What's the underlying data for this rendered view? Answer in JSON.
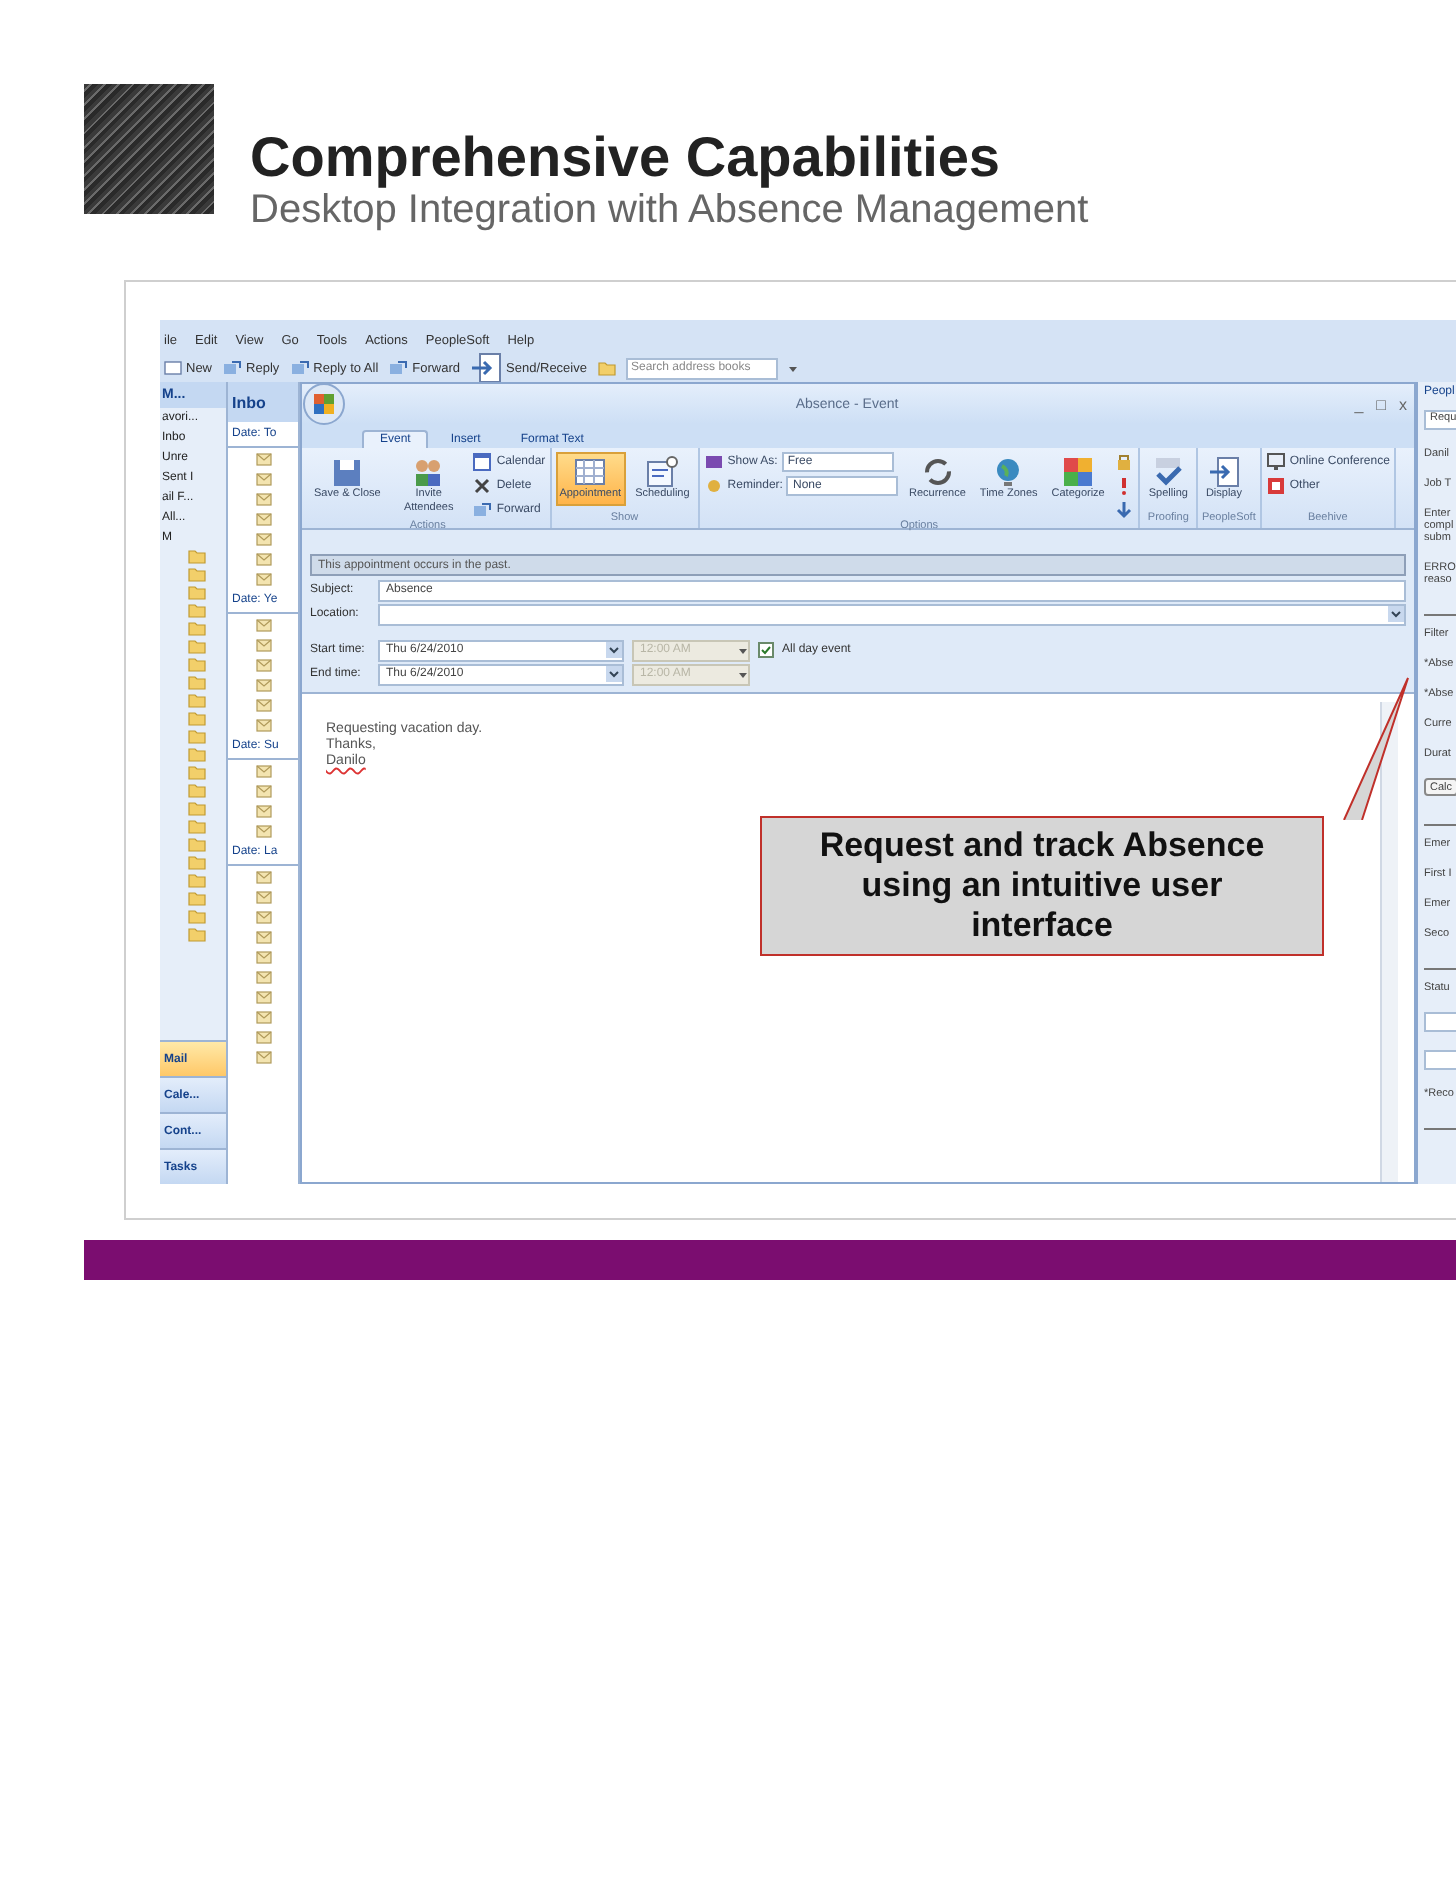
{
  "slide": {
    "title": "Comprehensive Capabilities",
    "subtitle": "Desktop Integration with Absence Management"
  },
  "outlook": {
    "menu": [
      "ile",
      "Edit",
      "View",
      "Go",
      "Tools",
      "Actions",
      "PeopleSoft",
      "Help"
    ],
    "toolbar": {
      "buttons": [
        "New",
        "Reply",
        "Reply to All",
        "Forward",
        "Send/Receive"
      ],
      "search_placeholder": "Search address books"
    },
    "nav_pane": {
      "header": "M...",
      "favorites": "avori...",
      "favorite_folders": [
        "Inbo",
        "Unre",
        "Sent I"
      ],
      "mail_folders": "ail F...",
      "view": "All...",
      "root": "M",
      "buttons": [
        {
          "label": "Mail",
          "selected": true
        },
        {
          "label": "Cale...",
          "selected": false
        },
        {
          "label": "Cont...",
          "selected": false
        },
        {
          "label": "Tasks",
          "selected": false
        }
      ]
    },
    "message_list": {
      "header": "Inbo",
      "groups": [
        "Date: To",
        "Date: Ye",
        "Date: Su",
        "Date: La"
      ]
    },
    "event": {
      "title": "Absence - Event",
      "window_controls": [
        "_",
        "□",
        "x"
      ],
      "tabs": [
        {
          "label": "Event",
          "selected": true
        },
        {
          "label": "Insert",
          "selected": false
        },
        {
          "label": "Format Text",
          "selected": false
        }
      ],
      "ribbon": [
        {
          "label": "Actions",
          "columns": [
            [
              {
                "kind": "large",
                "label": "Save & Close"
              }
            ],
            [
              {
                "kind": "large",
                "label": "Invite Attendees"
              }
            ],
            [
              {
                "kind": "small",
                "label": "Calendar"
              },
              {
                "kind": "small",
                "label": "Delete"
              },
              {
                "kind": "small",
                "label": "Forward"
              }
            ]
          ]
        },
        {
          "label": "Show",
          "columns": [
            [
              {
                "kind": "large",
                "label": "Appointment",
                "selected": true
              }
            ],
            [
              {
                "kind": "large",
                "label": "Scheduling",
                "selected": false
              }
            ]
          ]
        },
        {
          "label": "Options",
          "columns": [
            [
              {
                "kind": "select",
                "label": "Show As:",
                "value": "Free"
              },
              {
                "kind": "select",
                "label": "Reminder:",
                "value": "None"
              }
            ],
            [
              {
                "kind": "large",
                "label": "Recurrence"
              }
            ],
            [
              {
                "kind": "large",
                "label": "Time Zones"
              }
            ],
            [
              {
                "kind": "large",
                "label": "Categorize"
              }
            ],
            [
              {
                "kind": "icon"
              },
              {
                "kind": "icon"
              },
              {
                "kind": "icon"
              }
            ]
          ]
        },
        {
          "label": "Proofing",
          "columns": [
            [
              {
                "kind": "large",
                "label": "Spelling"
              }
            ]
          ]
        },
        {
          "label": "PeopleSoft",
          "columns": [
            [
              {
                "kind": "large",
                "label": "Display"
              }
            ]
          ]
        },
        {
          "label": "Beehive",
          "columns": [
            [
              {
                "kind": "small",
                "label": "Online Conference"
              },
              {
                "kind": "small",
                "label": "Other"
              }
            ]
          ]
        }
      ],
      "info": "This appointment occurs in the past.",
      "subject_label": "Subject:",
      "subject": "Absence",
      "location_label": "Location:",
      "start_label": "Start time:",
      "start_date": "Thu 6/24/2010",
      "start_time": "12:00 AM",
      "end_label": "End time:",
      "end_date": "Thu 6/24/2010",
      "end_time": "12:00 AM",
      "all_day_label": "All day event",
      "all_day": true,
      "body": [
        "Requesting vacation day.",
        "Thanks,",
        "Danilo"
      ]
    },
    "side_panel": {
      "title": "Peopl",
      "sections": [
        [
          {
            "kind": "field",
            "text": "Requ"
          },
          {
            "kind": "label",
            "text": "Danil"
          },
          {
            "kind": "label",
            "text": "Job T"
          },
          {
            "kind": "label",
            "text": "Enter compl subm"
          },
          {
            "kind": "label",
            "text": "ERRO reaso"
          }
        ],
        [
          {
            "kind": "label",
            "text": "Filter"
          },
          {
            "kind": "label",
            "text": "*Abse"
          },
          {
            "kind": "label",
            "text": "*Abse"
          },
          {
            "kind": "label",
            "text": "Curre"
          },
          {
            "kind": "label",
            "text": "Durat"
          },
          {
            "kind": "button",
            "text": "Calc"
          }
        ],
        [
          {
            "kind": "label",
            "text": "Emer"
          },
          {
            "kind": "label",
            "text": "First I"
          },
          {
            "kind": "label",
            "text": "Emer"
          },
          {
            "kind": "label",
            "text": "Seco"
          }
        ],
        [
          {
            "kind": "label",
            "text": "Statu"
          },
          {
            "kind": "field"
          },
          {
            "kind": "field"
          },
          {
            "kind": "label",
            "text": "*Reco"
          }
        ]
      ]
    }
  },
  "callout": "Request and track Absence using an intuitive user interface"
}
